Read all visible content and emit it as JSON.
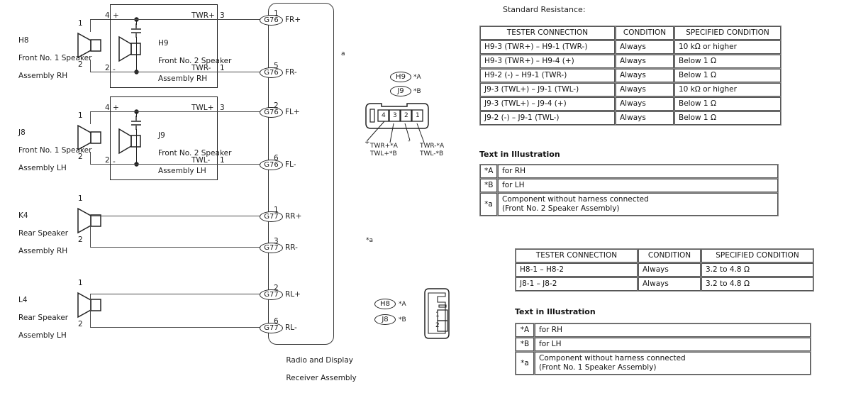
{
  "diagram": {
    "components": [
      {
        "code": "H8",
        "line2": "Front No. 1 Speaker",
        "line3": "Assembly RH",
        "pin_top": "1",
        "pin_bottom": "2"
      },
      {
        "code": "J8",
        "line2": "Front No. 1 Speaker",
        "line3": "Assembly LH",
        "pin_top": "1",
        "pin_bottom": "2"
      },
      {
        "code": "K4",
        "line2": "Rear Speaker",
        "line3": "Assembly RH",
        "pin_top": "1",
        "pin_bottom": "2"
      },
      {
        "code": "L4",
        "line2": "Rear Speaker",
        "line3": "Assembly LH",
        "pin_top": "1",
        "pin_bottom": "2"
      }
    ],
    "tweeters": [
      {
        "code": "H9",
        "line2": "Front No. 2 Speaker",
        "line3": "Assembly RH",
        "in_pin_top": "4",
        "in_sign_top": "+",
        "in_pin_bottom": "2",
        "in_sign_bottom": "-",
        "out_label_top": "TWR+",
        "out_pin_top": "3",
        "out_label_bottom": "TWR-",
        "out_pin_bottom": "1"
      },
      {
        "code": "J9",
        "line2": "Front No. 2 Speaker",
        "line3": "Assembly LH",
        "in_pin_top": "4",
        "in_sign_top": "+",
        "in_pin_bottom": "2",
        "in_sign_bottom": "-",
        "out_label_top": "TWL+",
        "out_pin_top": "3",
        "out_label_bottom": "TWL-",
        "out_pin_bottom": "1"
      }
    ],
    "receiver": {
      "label_line1": "Radio and Display",
      "label_line2": "Receiver Assembly",
      "marker_a": "a",
      "terminals": [
        {
          "pin": "1",
          "connector": "G76",
          "signal": "FR+"
        },
        {
          "pin": "5",
          "connector": "G76",
          "signal": "FR-"
        },
        {
          "pin": "2",
          "connector": "G76",
          "signal": "FL+"
        },
        {
          "pin": "6",
          "connector": "G76",
          "signal": "FL-"
        },
        {
          "pin": "1",
          "connector": "G77",
          "signal": "RR+"
        },
        {
          "pin": "3",
          "connector": "G77",
          "signal": "RR-"
        },
        {
          "pin": "2",
          "connector": "G77",
          "signal": "RL+"
        },
        {
          "pin": "6",
          "connector": "G77",
          "signal": "RL-"
        }
      ]
    },
    "marker_star_a": "*a",
    "connector_front2": {
      "badge_a_code": "H9",
      "badge_a_note": "*A",
      "badge_b_code": "J9",
      "badge_b_note": "*B",
      "pins": [
        "4",
        "3",
        "2",
        "1"
      ],
      "leader_far_left": "+",
      "leader_mid": "-",
      "callout_left_line1": "TWR+*A",
      "callout_left_line2": "TWL+*B",
      "callout_right_line1": "TWR-*A",
      "callout_right_line2": "TWL-*B"
    },
    "connector_front1": {
      "badge_a_code": "H8",
      "badge_a_note": "*A",
      "badge_b_code": "J8",
      "badge_b_note": "*B",
      "pins": [
        "1",
        "2"
      ]
    }
  },
  "right": {
    "standard_resistance_title": "Standard Resistance:",
    "table1": {
      "headers": [
        "TESTER CONNECTION",
        "CONDITION",
        "SPECIFIED CONDITION"
      ],
      "rows": [
        [
          "H9-3 (TWR+) – H9-1 (TWR-)",
          "Always",
          "10 kΩ or higher"
        ],
        [
          "H9-3 (TWR+) – H9-4 (+)",
          "Always",
          "Below 1 Ω"
        ],
        [
          "H9-2 (-) – H9-1 (TWR-)",
          "Always",
          "Below 1 Ω"
        ],
        [
          "J9-3 (TWL+) – J9-1 (TWL-)",
          "Always",
          "10 kΩ or higher"
        ],
        [
          "J9-3 (TWL+) – J9-4 (+)",
          "Always",
          "Below 1 Ω"
        ],
        [
          "J9-2 (-) – J9-1 (TWL-)",
          "Always",
          "Below 1 Ω"
        ]
      ]
    },
    "text_in_illustration_title_1": "Text in Illustration",
    "table2": {
      "rows": [
        {
          "key": "*A",
          "value": "for RH"
        },
        {
          "key": "*B",
          "value": "for LH"
        },
        {
          "key": "*a",
          "value": "Component without harness connected\n(Front No. 2 Speaker Assembly)"
        }
      ]
    },
    "table3": {
      "headers": [
        "TESTER CONNECTION",
        "CONDITION",
        "SPECIFIED CONDITION"
      ],
      "rows": [
        [
          "H8-1 – H8-2",
          "Always",
          "3.2 to 4.8 Ω"
        ],
        [
          "J8-1 – J8-2",
          "Always",
          "3.2 to 4.8 Ω"
        ]
      ]
    },
    "text_in_illustration_title_2": "Text in Illustration",
    "table4": {
      "rows": [
        {
          "key": "*A",
          "value": "for RH"
        },
        {
          "key": "*B",
          "value": "for LH"
        },
        {
          "key": "*a",
          "value": "Component without harness connected\n(Front No. 1 Speaker Assembly)"
        }
      ]
    }
  }
}
